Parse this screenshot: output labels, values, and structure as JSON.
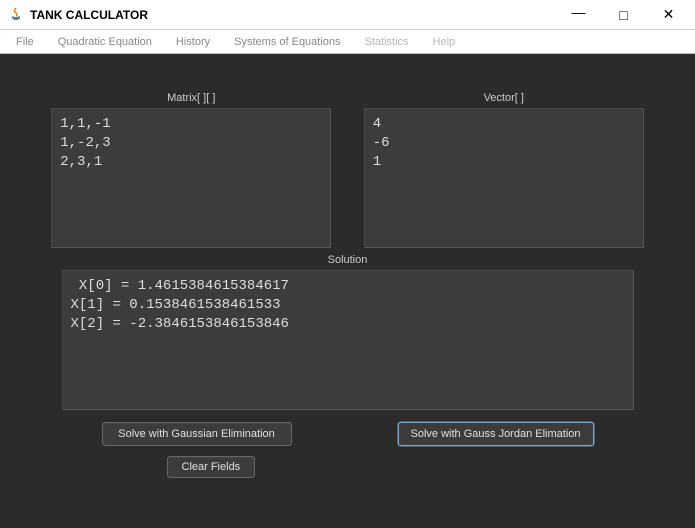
{
  "window": {
    "title": "TANK CALCULATOR",
    "min": "—",
    "max": "□",
    "close": "✕"
  },
  "menu": {
    "file": "File",
    "quadratic": "Quadratic Equation",
    "history": "History",
    "systems": "Systems of Equations",
    "statistics": "Statistics",
    "help": "Help"
  },
  "labels": {
    "matrix": "Matrix[ ][ ]",
    "vector": "Vector[ ]",
    "solution": "Solution"
  },
  "inputs": {
    "matrix": "1,1,-1\n1,-2,3\n2,3,1",
    "vector": "4\n-6\n1",
    "solution": " X[0] = 1.4615384615384617\nX[1] = 0.1538461538461533\nX[2] = -2.3846153846153846"
  },
  "buttons": {
    "gaussian": "Solve with Gaussian Elimination",
    "gaussjordan": "Solve with Gauss Jordan Elimation",
    "clear": "Clear Fields"
  }
}
